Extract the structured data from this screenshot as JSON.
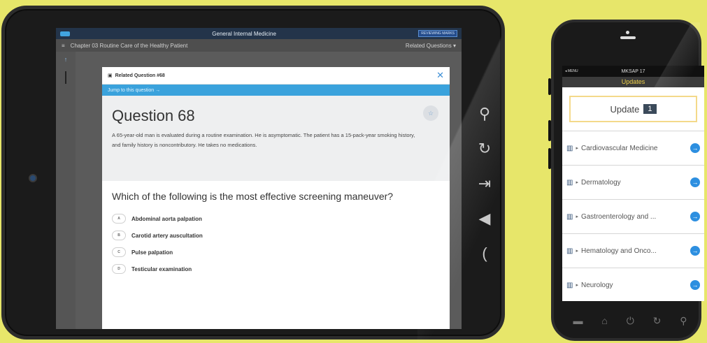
{
  "tablet": {
    "app_title": "General Internal Medicine",
    "badge": "REVIEWING MARKS",
    "chapter": "Chapter 03  Routine Care of the Healthy Patient",
    "related": "Related Questions",
    "modal": {
      "header": "Related  Question #68",
      "jump": "Jump to this question →",
      "title": "Question 68",
      "vignette": "A 65-year-old man is evaluated during a routine examination. He is asymptomatic. The patient has a 15-pack-year smoking history, and family history is noncontributory. He takes no medications.",
      "prompt": "Which of the following is the most effective screening maneuver?",
      "options": [
        {
          "letter": "A",
          "text": "Abdominal aorta palpation"
        },
        {
          "letter": "B",
          "text": "Carotid artery auscultation"
        },
        {
          "letter": "C",
          "text": "Pulse palpation"
        },
        {
          "letter": "D",
          "text": "Testicular examination"
        }
      ]
    },
    "side_icons": [
      "search-icon",
      "refresh-icon",
      "enter-icon",
      "back-icon",
      "bracket-icon"
    ]
  },
  "phone": {
    "menu": "◂ MENU",
    "title": "MKSAP 17",
    "subtitle": "Updates",
    "update_label": "Update",
    "update_count": "1",
    "rows": [
      "Cardiovascular Medicine",
      "Dermatology",
      "Gastroenterology and ...",
      "Hematology and Onco...",
      "Neurology"
    ]
  }
}
